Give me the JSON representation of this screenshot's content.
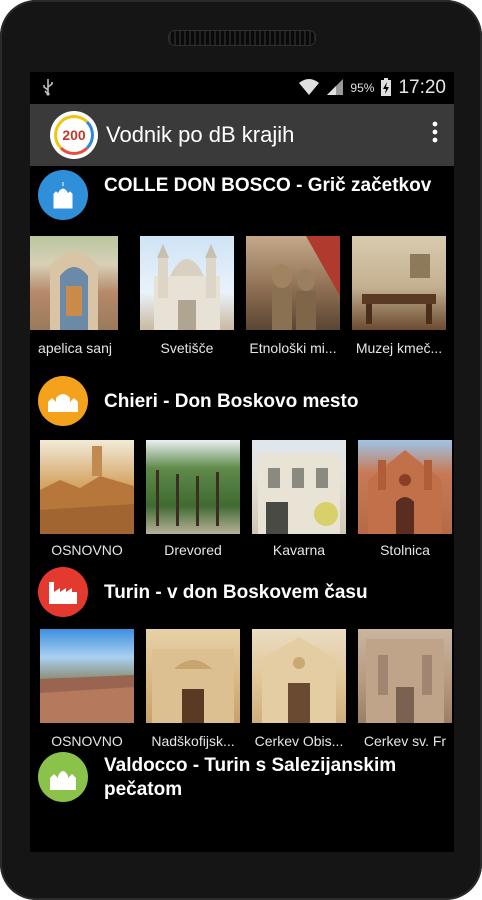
{
  "status": {
    "battery": "95",
    "battery_unit": "%",
    "time": "17:20"
  },
  "appbar": {
    "title": "Vodnik po dB krajih",
    "logo_text": "200"
  },
  "colors": {
    "blue": "#2f8fd8",
    "orange": "#f4a21b",
    "red": "#e3392e",
    "green": "#8bc34a"
  },
  "sections": [
    {
      "title": "COLLE DON BOSCO - Grič začetkov",
      "icon": "church-dome-icon",
      "color": "#2f8fd8",
      "tiles": [
        {
          "label": "Kapelica sanj",
          "caption_visible": "apelica sanj"
        },
        {
          "label": "Svetišče"
        },
        {
          "label": "Etnološki mi..."
        },
        {
          "label": "Muzej kmeč..."
        }
      ]
    },
    {
      "title": "Chieri - Don Boskovo mesto",
      "icon": "cathedral-icon",
      "color": "#f4a21b",
      "tiles": [
        {
          "label": "OSNOVNO"
        },
        {
          "label": "Drevored"
        },
        {
          "label": "Kavarna"
        },
        {
          "label": "Stolnica"
        }
      ]
    },
    {
      "title": "Turin - v don Boskovem času",
      "icon": "factory-icon",
      "color": "#e3392e",
      "tiles": [
        {
          "label": "OSNOVNO"
        },
        {
          "label": "Nadškofijsk..."
        },
        {
          "label": "Cerkev Obis..."
        },
        {
          "label": "Cerkev sv. Fr"
        }
      ]
    },
    {
      "title": "Valdocco - Turin s Salezijanskim pečatom",
      "icon": "basilica-icon",
      "color": "#8bc34a",
      "tiles": []
    }
  ]
}
